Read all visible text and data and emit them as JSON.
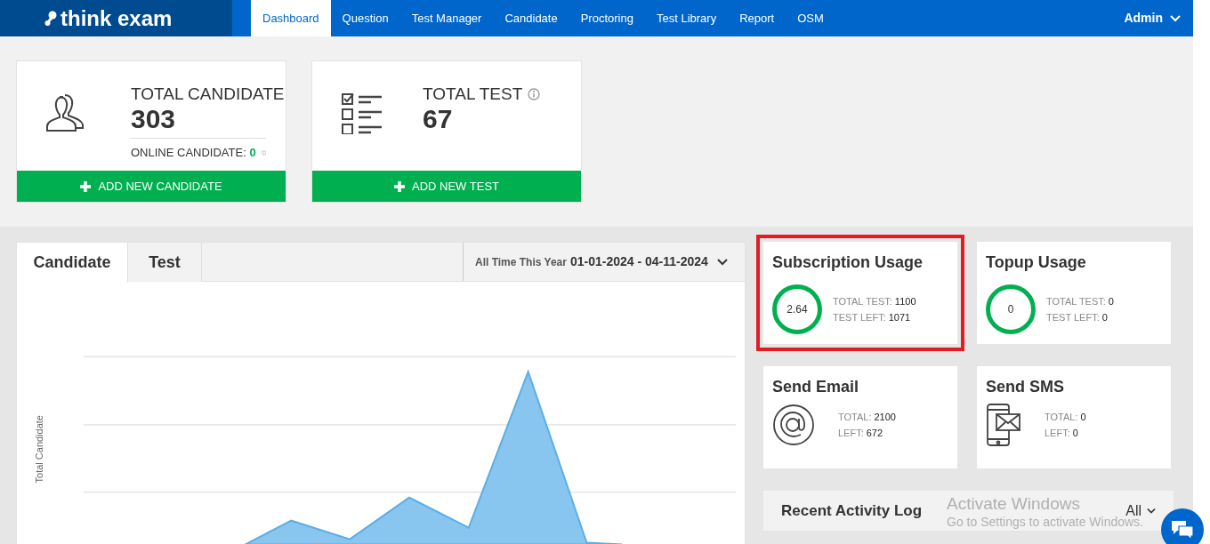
{
  "brand": {
    "name": "think exam"
  },
  "nav": [
    {
      "label": "Dashboard",
      "selected": true
    },
    {
      "label": "Question",
      "selected": false
    },
    {
      "label": "Test Manager",
      "selected": false
    },
    {
      "label": "Candidate",
      "selected": false
    },
    {
      "label": "Proctoring",
      "selected": false
    },
    {
      "label": "Test Library",
      "selected": false
    },
    {
      "label": "Report",
      "selected": false
    },
    {
      "label": "OSM",
      "selected": false
    }
  ],
  "user_menu": {
    "label": "Admin"
  },
  "stat_cards": [
    {
      "kind": "candidate",
      "title": "TOTAL CANDIDATE",
      "value": "303",
      "sub_label": "ONLINE CANDIDATE:",
      "sub_value": "0",
      "action": "ADD NEW CANDIDATE"
    },
    {
      "kind": "test",
      "title": "TOTAL TEST",
      "value": "67",
      "action": "ADD NEW TEST"
    }
  ],
  "chart_panel": {
    "tabs": [
      {
        "label": "Candidate",
        "selected": true
      },
      {
        "label": "Test",
        "selected": false
      }
    ],
    "range_label": "All Time This Year",
    "range_value": "01-01-2024 - 04-11-2024",
    "ylabel": "Total Candidate"
  },
  "usage_cards": [
    {
      "kind": "ring",
      "title": "Subscription Usage",
      "ring_value": "2.64",
      "highlighted": true,
      "rows": [
        {
          "label": "TOTAL TEST:",
          "value": "1100"
        },
        {
          "label": "TEST LEFT:",
          "value": "1071"
        }
      ]
    },
    {
      "kind": "ring",
      "title": "Topup Usage",
      "ring_value": "0",
      "highlighted": false,
      "rows": [
        {
          "label": "TOTAL TEST:",
          "value": "0"
        },
        {
          "label": "TEST LEFT:",
          "value": "0"
        }
      ]
    },
    {
      "kind": "email",
      "title": "Send Email",
      "highlighted": false,
      "rows": [
        {
          "label": "TOTAL:",
          "value": "2100"
        },
        {
          "label": "LEFT:",
          "value": "672"
        }
      ]
    },
    {
      "kind": "sms",
      "title": "Send SMS",
      "highlighted": false,
      "rows": [
        {
          "label": "TOTAL:",
          "value": "0"
        },
        {
          "label": "LEFT:",
          "value": "0"
        }
      ]
    }
  ],
  "activity_log": {
    "title": "Recent Activity Log",
    "filter": "All"
  },
  "os_overlay": {
    "title": "Activate Windows",
    "message": "Go to Settings to activate Windows."
  }
}
